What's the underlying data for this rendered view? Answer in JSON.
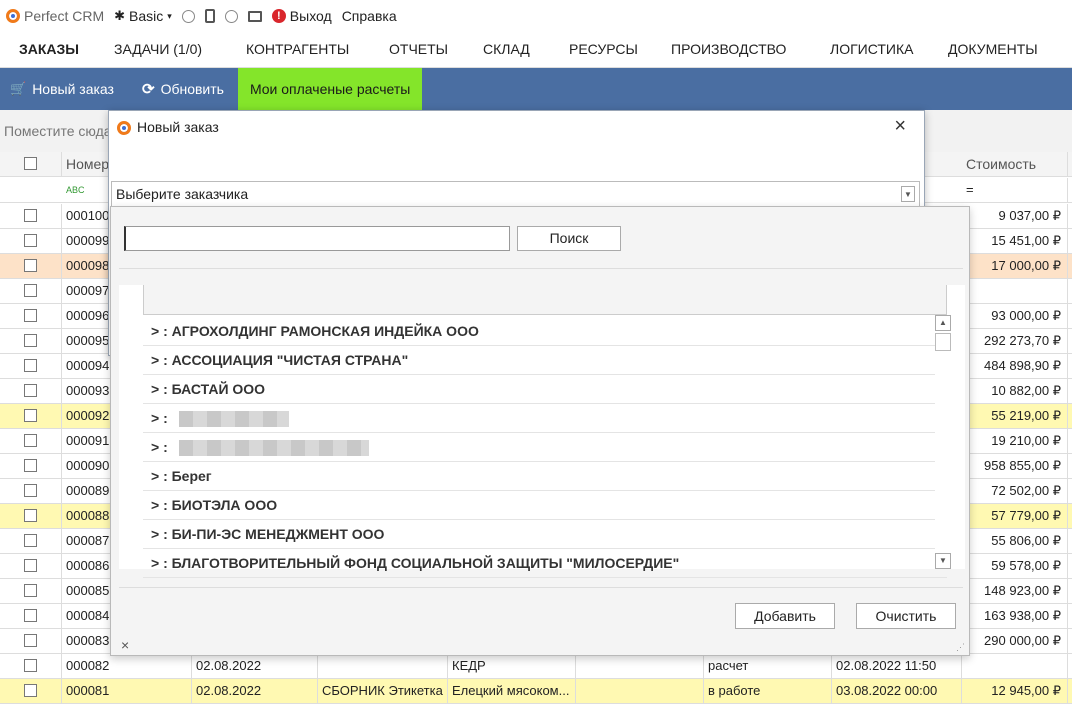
{
  "topbar": {
    "app_title": "Perfect CRM",
    "plan": "Basic",
    "exit": "Выход",
    "help": "Справка"
  },
  "menu": [
    "ЗАКАЗЫ",
    "ЗАДАЧИ (1/0)",
    "КОНТРАГЕНТЫ",
    "ОТЧЕТЫ",
    "СКЛАД",
    "РЕСУРСЫ",
    "ПРОИЗВОДСТВО",
    "ЛОГИСТИКА",
    "ДОКУМЕНТЫ"
  ],
  "toolbar": {
    "new_order": "Новый заказ",
    "refresh": "Обновить",
    "my_paid": "Мои оплаченые расчеты"
  },
  "grid": {
    "group_hint": "Поместите сюда",
    "col_number": "Номер",
    "col_cost": "Стоимость",
    "filter_cost": "=",
    "rows": [
      {
        "num": "000100",
        "cost": "9 037,00 ₽"
      },
      {
        "num": "000099",
        "cost": "15 451,00 ₽"
      },
      {
        "num": "000098",
        "cost": "17 000,00 ₽"
      },
      {
        "num": "000097",
        "cost": ""
      },
      {
        "num": "000096",
        "cost": "93 000,00 ₽"
      },
      {
        "num": "000095",
        "cost": "292 273,70 ₽"
      },
      {
        "num": "000094",
        "cost": "484 898,90 ₽"
      },
      {
        "num": "000093",
        "cost": "10 882,00 ₽"
      },
      {
        "num": "000092",
        "cost": "55 219,00 ₽"
      },
      {
        "num": "000091",
        "cost": "19 210,00 ₽"
      },
      {
        "num": "000090",
        "cost": "958 855,00 ₽"
      },
      {
        "num": "000089",
        "cost": "72 502,00 ₽"
      },
      {
        "num": "000088",
        "cost": "57 779,00 ₽"
      },
      {
        "num": "000087",
        "cost": "55 806,00 ₽"
      },
      {
        "num": "000086",
        "cost": "59 578,00 ₽"
      },
      {
        "num": "000085",
        "cost": "148 923,00 ₽"
      },
      {
        "num": "000084",
        "cost": "163 938,00 ₽"
      },
      {
        "num": "000083",
        "cost": "290 000,00 ₽"
      },
      {
        "num": "000082",
        "date": "02.08.2022",
        "product": "",
        "client": "КЕДР",
        "status": "расчет",
        "deadline": "02.08.2022 11:50",
        "cost": ""
      },
      {
        "num": "000081",
        "date": "02.08.2022",
        "product": "СБОРНИК Этикетка",
        "client": "Елецкий мясоком...",
        "status": "в работе",
        "deadline": "03.08.2022 00:00",
        "cost": "12 945,00 ₽"
      }
    ]
  },
  "dialog": {
    "title": "Новый заказ",
    "customer_placeholder": "Выберите заказчика"
  },
  "dropdown": {
    "search_value": "",
    "search_button": "Поиск",
    "items": [
      "> : АГРОХОЛДИНГ РАМОНСКАЯ ИНДЕЙКА ООО",
      "> : АССОЦИАЦИЯ \"ЧИСТАЯ СТРАНА\"",
      "> : БАСТАЙ ООО",
      "> :",
      "> :",
      "> : Берег",
      "> : БИОТЭЛА ООО",
      "> : БИ-ПИ-ЭС МЕНЕДЖМЕНТ ООО",
      "> : БЛАГОТВОРИТЕЛЬНЫЙ ФОНД  СОЦИАЛЬНОЙ ЗАЩИТЫ  \"МИЛОСЕРДИЕ\""
    ],
    "add_button": "Добавить",
    "clear_button": "Очистить",
    "close_x": "×"
  },
  "colors": {
    "toolbar_bg": "#4a6ea2",
    "accent_green": "#84e52a",
    "row_yellow": "#fff9b2",
    "row_orange": "#fde2c8"
  }
}
